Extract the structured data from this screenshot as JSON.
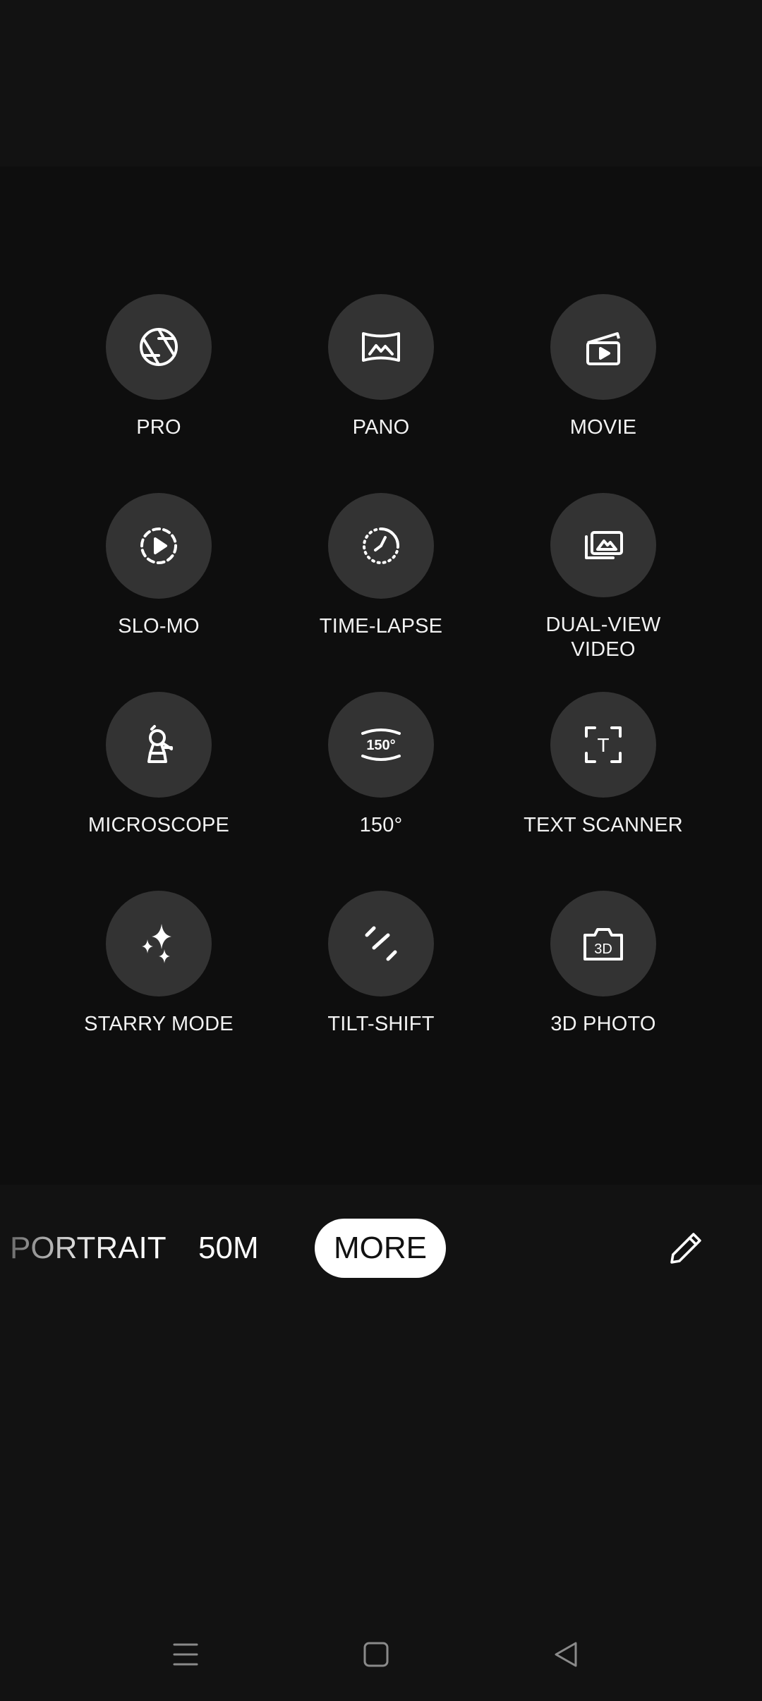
{
  "modes": [
    {
      "label": "PRO",
      "icon": "aperture-icon"
    },
    {
      "label": "PANO",
      "icon": "panorama-icon"
    },
    {
      "label": "MOVIE",
      "icon": "clapperboard-icon"
    },
    {
      "label": "SLO-MO",
      "icon": "slow-motion-icon"
    },
    {
      "label": "TIME-LAPSE",
      "icon": "time-lapse-icon"
    },
    {
      "label": "DUAL-VIEW\nVIDEO",
      "icon": "dual-view-icon"
    },
    {
      "label": "MICROSCOPE",
      "icon": "microscope-icon"
    },
    {
      "label": "150°",
      "icon": "wide-angle-150-icon",
      "icon_text": "150°"
    },
    {
      "label": "TEXT SCANNER",
      "icon": "text-scanner-icon",
      "icon_text": "T"
    },
    {
      "label": "STARRY MODE",
      "icon": "sparkles-icon"
    },
    {
      "label": "TILT-SHIFT",
      "icon": "tilt-shift-icon"
    },
    {
      "label": "3D PHOTO",
      "icon": "camera-3d-icon",
      "icon_text": "3D"
    }
  ],
  "mode_bar": {
    "portrait": "PORTRAIT",
    "fifty_m": "50M",
    "more": "MORE",
    "edit_icon": "pencil-icon"
  },
  "nav": {
    "menu_icon": "menu-icon",
    "home_icon": "home-square-icon",
    "back_icon": "back-triangle-icon"
  },
  "colors": {
    "background": "#121212",
    "circle": "#333333",
    "selected_pill": "#ffffff"
  }
}
